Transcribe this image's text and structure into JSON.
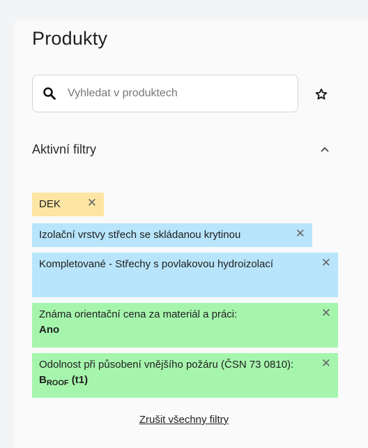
{
  "panel": {
    "title": "Produkty"
  },
  "search": {
    "placeholder": "Vyhledat v produktech",
    "icon": "search-icon"
  },
  "favorite": {
    "icon": "star-icon"
  },
  "active_filters": {
    "label": "Aktivní filtry",
    "collapse_icon": "chevron-up-icon",
    "chips": [
      {
        "text": "DEK",
        "color": "#fde6a4"
      },
      {
        "text": "Izolační vrstvy střech se skládanou krytinou",
        "color": "#b8e5fb"
      },
      {
        "text": "Kompletované - Střechy s povlakovou hydroizolací",
        "color": "#b8e5fb"
      },
      {
        "text": "Známa orientační cena za materiál a práci:",
        "value": "Ano",
        "color": "#a6f5ad"
      },
      {
        "text": "Odolnost při působení vnějšího požáru (ČSN 73 0810):",
        "value_main": "B",
        "value_sub": "ROOF",
        "value_suffix": " (t1)",
        "color": "#a6f5ad"
      }
    ],
    "remove_symbol": "✕"
  },
  "clear_all": {
    "label": "Zrušit všechny filtry"
  }
}
